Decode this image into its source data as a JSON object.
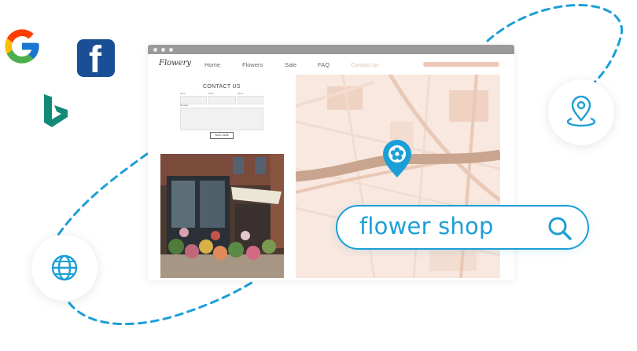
{
  "brand_logos": {
    "google": "G",
    "facebook": "f"
  },
  "browser": {
    "logo": "Flowery",
    "nav": [
      "Home",
      "Flowers",
      "Sale",
      "FAQ",
      "Contact us"
    ]
  },
  "contact": {
    "title": "CONTACT US",
    "labels": {
      "name": "Name",
      "email": "Email",
      "phone": "Phone",
      "message": "Message"
    },
    "send": "SEND HERE"
  },
  "search": {
    "value": "flower shop"
  },
  "colors": {
    "accent": "#1c9fd6",
    "map_bg": "#f8e8df",
    "road": "#c9a58f",
    "titlebar": "#9a9a9a",
    "facebook": "#1b4f95",
    "bing": "#138a78"
  },
  "icons": {
    "location_circle": "map-pin-icon",
    "globe_circle": "globe-icon",
    "search": "magnifier-icon",
    "map_marker": "flower-pin-icon"
  }
}
